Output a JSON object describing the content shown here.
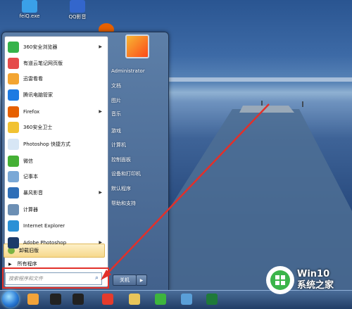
{
  "desktop": {
    "icons": [
      {
        "label": "feiQ.exe",
        "color": "#3aa0e8"
      },
      {
        "label": "QQ影音",
        "color": "#3366cc"
      }
    ]
  },
  "start_menu": {
    "programs": [
      {
        "label": "360安全浏览器",
        "icon": "360-browser-icon",
        "color": "#35b34a",
        "has_arrow": true
      },
      {
        "label": "有道云笔记网页版",
        "icon": "app-icon",
        "color": "#e54b4b",
        "has_arrow": false
      },
      {
        "label": "迅雷看看",
        "icon": "color-wheel-icon",
        "color": "#f3a532",
        "has_arrow": false
      },
      {
        "label": "腾讯电脑管家",
        "icon": "shield-icon",
        "color": "#1e7be2",
        "has_arrow": false
      },
      {
        "label": "Firefox",
        "icon": "firefox-icon",
        "color": "#e66000",
        "has_arrow": true
      },
      {
        "label": "360安全卫士",
        "icon": "color-wheel-icon",
        "color": "#f1c232",
        "has_arrow": false
      },
      {
        "label": "Photoshop 快捷方式",
        "icon": "photo-icon",
        "color": "#d7e6f5",
        "has_arrow": false
      },
      {
        "label": "微信",
        "icon": "wechat-icon",
        "color": "#45b035",
        "has_arrow": false
      },
      {
        "label": "记事本",
        "icon": "gear-icon",
        "color": "#7aa8d6",
        "has_arrow": false
      },
      {
        "label": "暴风影音",
        "icon": "media-icon",
        "color": "#2f6fb8",
        "has_arrow": true
      },
      {
        "label": "计算器",
        "icon": "calculator-icon",
        "color": "#6c8fb4",
        "has_arrow": false
      },
      {
        "label": "Internet Explorer",
        "icon": "ie-icon",
        "color": "#2a90d6",
        "has_arrow": false
      },
      {
        "label": "Adobe Photoshop",
        "icon": "ps-icon",
        "color": "#1c3b6a",
        "has_arrow": true
      }
    ],
    "uninstall_label": "卸载旧版",
    "all_programs_label": "所有程序",
    "search_placeholder": "搜索程序和文件",
    "user_name": "Administrator",
    "right_items": [
      "文档",
      "图片",
      "音乐",
      "游戏",
      "计算机",
      "控制面板",
      "设备和打印机",
      "默认程序",
      "帮助和支持"
    ],
    "shutdown_label": "关机"
  },
  "taskbar": {
    "buttons": [
      {
        "icon": "360-icon",
        "color": "#f2a33a"
      },
      {
        "icon": "media-icon",
        "color": "#222222"
      },
      {
        "icon": "qq-icon",
        "color": "#222222"
      },
      {
        "icon": "wps-icon",
        "color": "#e53b2c"
      },
      {
        "icon": "folder-icon",
        "color": "#e8c55a"
      },
      {
        "icon": "ie-icon",
        "color": "#3db53d"
      },
      {
        "icon": "notepad-icon",
        "color": "#5a9fd8"
      },
      {
        "icon": "excel-icon",
        "color": "#1f7a3a"
      }
    ]
  },
  "watermark": {
    "line1": "Win10",
    "line2": "系统之家"
  }
}
